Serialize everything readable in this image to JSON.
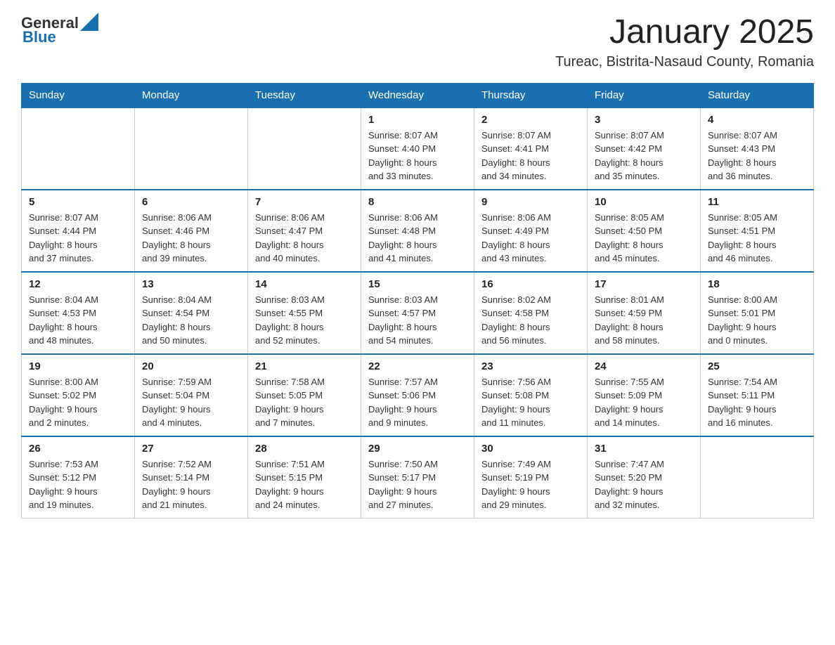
{
  "header": {
    "logo_general": "General",
    "logo_blue": "Blue",
    "month_title": "January 2025",
    "location": "Tureac, Bistrita-Nasaud County, Romania"
  },
  "weekdays": [
    "Sunday",
    "Monday",
    "Tuesday",
    "Wednesday",
    "Thursday",
    "Friday",
    "Saturday"
  ],
  "weeks": [
    [
      {
        "day": "",
        "info": ""
      },
      {
        "day": "",
        "info": ""
      },
      {
        "day": "",
        "info": ""
      },
      {
        "day": "1",
        "info": "Sunrise: 8:07 AM\nSunset: 4:40 PM\nDaylight: 8 hours\nand 33 minutes."
      },
      {
        "day": "2",
        "info": "Sunrise: 8:07 AM\nSunset: 4:41 PM\nDaylight: 8 hours\nand 34 minutes."
      },
      {
        "day": "3",
        "info": "Sunrise: 8:07 AM\nSunset: 4:42 PM\nDaylight: 8 hours\nand 35 minutes."
      },
      {
        "day": "4",
        "info": "Sunrise: 8:07 AM\nSunset: 4:43 PM\nDaylight: 8 hours\nand 36 minutes."
      }
    ],
    [
      {
        "day": "5",
        "info": "Sunrise: 8:07 AM\nSunset: 4:44 PM\nDaylight: 8 hours\nand 37 minutes."
      },
      {
        "day": "6",
        "info": "Sunrise: 8:06 AM\nSunset: 4:46 PM\nDaylight: 8 hours\nand 39 minutes."
      },
      {
        "day": "7",
        "info": "Sunrise: 8:06 AM\nSunset: 4:47 PM\nDaylight: 8 hours\nand 40 minutes."
      },
      {
        "day": "8",
        "info": "Sunrise: 8:06 AM\nSunset: 4:48 PM\nDaylight: 8 hours\nand 41 minutes."
      },
      {
        "day": "9",
        "info": "Sunrise: 8:06 AM\nSunset: 4:49 PM\nDaylight: 8 hours\nand 43 minutes."
      },
      {
        "day": "10",
        "info": "Sunrise: 8:05 AM\nSunset: 4:50 PM\nDaylight: 8 hours\nand 45 minutes."
      },
      {
        "day": "11",
        "info": "Sunrise: 8:05 AM\nSunset: 4:51 PM\nDaylight: 8 hours\nand 46 minutes."
      }
    ],
    [
      {
        "day": "12",
        "info": "Sunrise: 8:04 AM\nSunset: 4:53 PM\nDaylight: 8 hours\nand 48 minutes."
      },
      {
        "day": "13",
        "info": "Sunrise: 8:04 AM\nSunset: 4:54 PM\nDaylight: 8 hours\nand 50 minutes."
      },
      {
        "day": "14",
        "info": "Sunrise: 8:03 AM\nSunset: 4:55 PM\nDaylight: 8 hours\nand 52 minutes."
      },
      {
        "day": "15",
        "info": "Sunrise: 8:03 AM\nSunset: 4:57 PM\nDaylight: 8 hours\nand 54 minutes."
      },
      {
        "day": "16",
        "info": "Sunrise: 8:02 AM\nSunset: 4:58 PM\nDaylight: 8 hours\nand 56 minutes."
      },
      {
        "day": "17",
        "info": "Sunrise: 8:01 AM\nSunset: 4:59 PM\nDaylight: 8 hours\nand 58 minutes."
      },
      {
        "day": "18",
        "info": "Sunrise: 8:00 AM\nSunset: 5:01 PM\nDaylight: 9 hours\nand 0 minutes."
      }
    ],
    [
      {
        "day": "19",
        "info": "Sunrise: 8:00 AM\nSunset: 5:02 PM\nDaylight: 9 hours\nand 2 minutes."
      },
      {
        "day": "20",
        "info": "Sunrise: 7:59 AM\nSunset: 5:04 PM\nDaylight: 9 hours\nand 4 minutes."
      },
      {
        "day": "21",
        "info": "Sunrise: 7:58 AM\nSunset: 5:05 PM\nDaylight: 9 hours\nand 7 minutes."
      },
      {
        "day": "22",
        "info": "Sunrise: 7:57 AM\nSunset: 5:06 PM\nDaylight: 9 hours\nand 9 minutes."
      },
      {
        "day": "23",
        "info": "Sunrise: 7:56 AM\nSunset: 5:08 PM\nDaylight: 9 hours\nand 11 minutes."
      },
      {
        "day": "24",
        "info": "Sunrise: 7:55 AM\nSunset: 5:09 PM\nDaylight: 9 hours\nand 14 minutes."
      },
      {
        "day": "25",
        "info": "Sunrise: 7:54 AM\nSunset: 5:11 PM\nDaylight: 9 hours\nand 16 minutes."
      }
    ],
    [
      {
        "day": "26",
        "info": "Sunrise: 7:53 AM\nSunset: 5:12 PM\nDaylight: 9 hours\nand 19 minutes."
      },
      {
        "day": "27",
        "info": "Sunrise: 7:52 AM\nSunset: 5:14 PM\nDaylight: 9 hours\nand 21 minutes."
      },
      {
        "day": "28",
        "info": "Sunrise: 7:51 AM\nSunset: 5:15 PM\nDaylight: 9 hours\nand 24 minutes."
      },
      {
        "day": "29",
        "info": "Sunrise: 7:50 AM\nSunset: 5:17 PM\nDaylight: 9 hours\nand 27 minutes."
      },
      {
        "day": "30",
        "info": "Sunrise: 7:49 AM\nSunset: 5:19 PM\nDaylight: 9 hours\nand 29 minutes."
      },
      {
        "day": "31",
        "info": "Sunrise: 7:47 AM\nSunset: 5:20 PM\nDaylight: 9 hours\nand 32 minutes."
      },
      {
        "day": "",
        "info": ""
      }
    ]
  ]
}
